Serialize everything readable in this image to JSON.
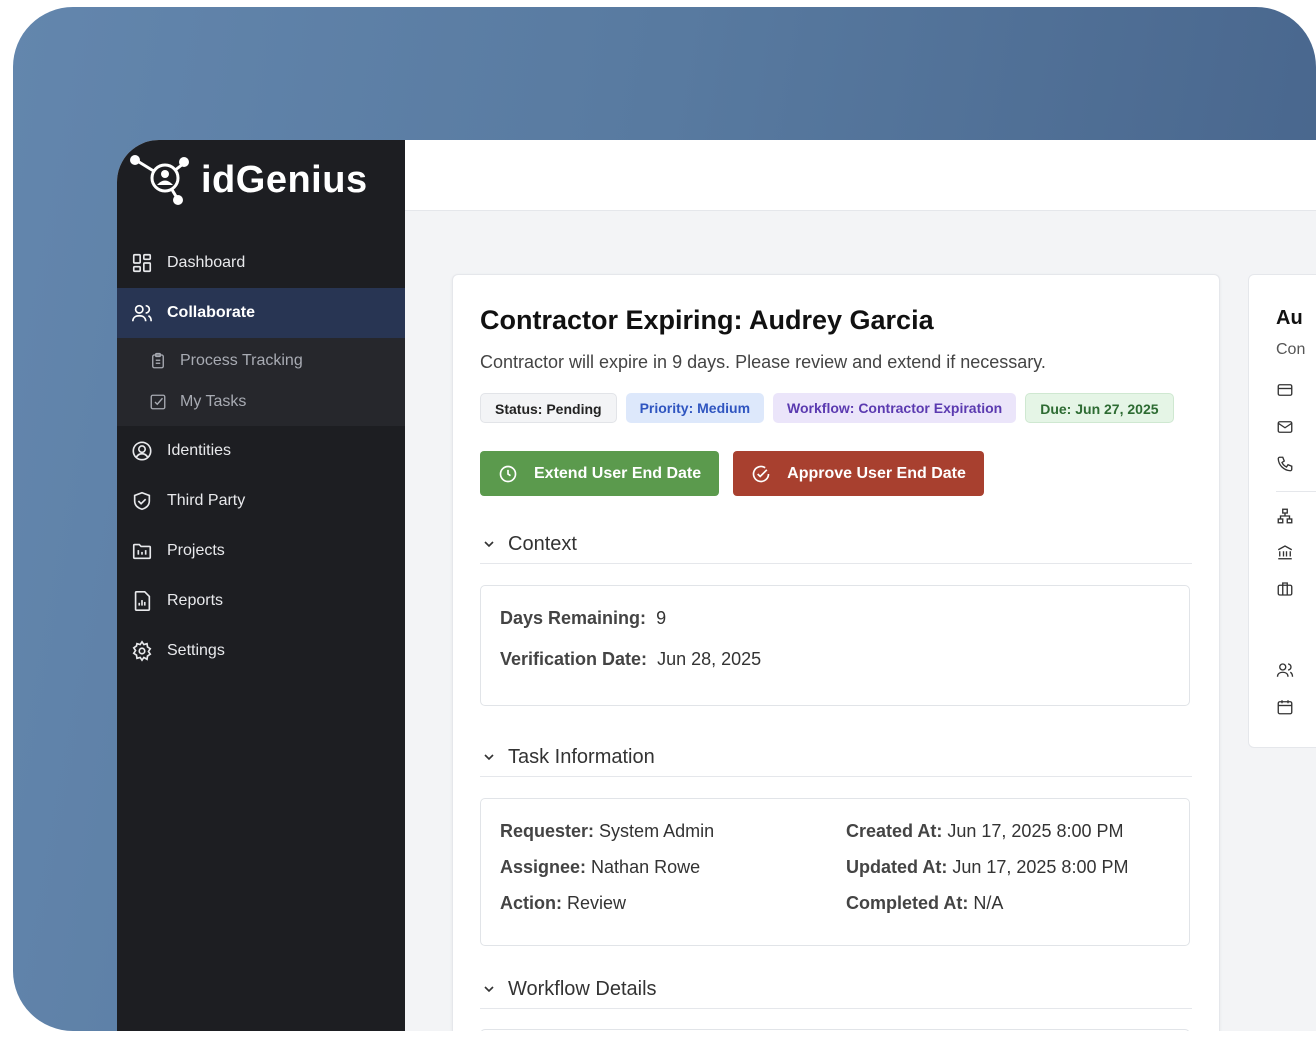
{
  "brand": {
    "name": "idGenius"
  },
  "nav": {
    "dashboard": "Dashboard",
    "collaborate": "Collaborate",
    "process_tracking": "Process Tracking",
    "my_tasks": "My Tasks",
    "identities": "Identities",
    "third_party": "Third Party",
    "projects": "Projects",
    "reports": "Reports",
    "settings": "Settings"
  },
  "task": {
    "title": "Contractor Expiring: Audrey Garcia",
    "description": "Contractor will expire in 9 days. Please review and extend if necessary.",
    "badges": {
      "status": "Status: Pending",
      "priority": "Priority: Medium",
      "workflow": "Workflow: Contractor Expiration",
      "due": "Due: Jun 27, 2025"
    },
    "actions": {
      "extend": "Extend User End Date",
      "approve": "Approve User End Date"
    }
  },
  "context": {
    "heading": "Context",
    "days_remaining_label": "Days Remaining:",
    "days_remaining_value": "9",
    "verification_label": "Verification Date:",
    "verification_value": "Jun 28, 2025"
  },
  "task_info": {
    "heading": "Task Information",
    "requester_label": "Requester:",
    "requester_value": "System Admin",
    "assignee_label": "Assignee:",
    "assignee_value": "Nathan Rowe",
    "action_label": "Action:",
    "action_value": "Review",
    "created_label": "Created At:",
    "created_value": "Jun 17, 2025 8:00 PM",
    "updated_label": "Updated At:",
    "updated_value": "Jun 17, 2025 8:00 PM",
    "completed_label": "Completed At:",
    "completed_value": "N/A"
  },
  "workflow": {
    "heading": "Workflow Details"
  },
  "side_card": {
    "title": "Au",
    "subtitle": "Con"
  },
  "colors": {
    "extend_button": "#5b9a4d",
    "approve_button": "#a8402f",
    "sidebar_bg": "#1d1e22",
    "active_nav_bg": "#283553"
  }
}
